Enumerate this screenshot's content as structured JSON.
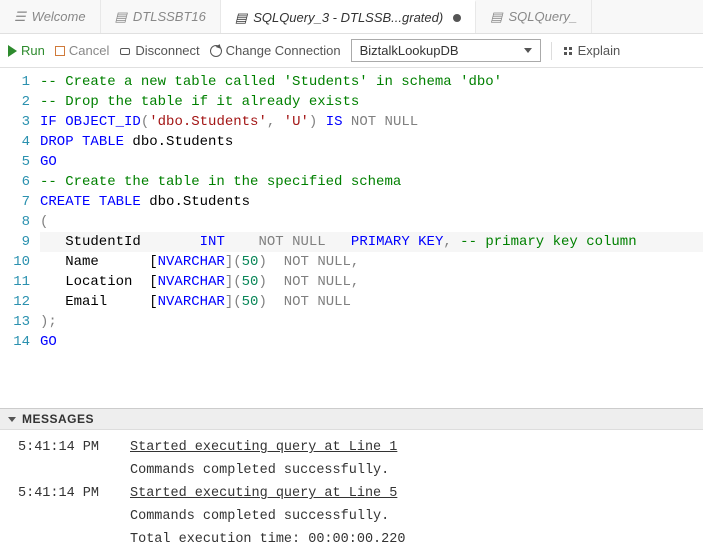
{
  "tabs": {
    "welcome": "Welcome",
    "t1": "DTLSSBT16",
    "active": "SQLQuery_3 - DTLSSB...grated)",
    "t3": "SQLQuery_"
  },
  "toolbar": {
    "run": "Run",
    "cancel": "Cancel",
    "disconnect": "Disconnect",
    "change_conn": "Change Connection",
    "db_selected": "BiztalkLookupDB",
    "explain": "Explain"
  },
  "editor": {
    "lines": {
      "l1": "-- Create a new table called 'Students' in schema 'dbo'",
      "l2": "-- Drop the table if it already exists",
      "l3_if": "IF",
      "l3_fn": " OBJECT_ID",
      "l3_p": "(",
      "l3_s1": "'dbo.Students'",
      "l3_c": ", ",
      "l3_s2": "'U'",
      "l3_p2": ") ",
      "l3_is": "IS",
      "l3_sp": " ",
      "l3_not": "NOT",
      "l3_sp2": " ",
      "l3_null": "NULL",
      "l4_drop": "DROP",
      "l4_sp": " ",
      "l4_table": "TABLE",
      "l4_rest": " dbo.Students",
      "l5": "GO",
      "l6": "-- Create the table in the specified schema",
      "l7_create": "CREATE",
      "l7_sp": " ",
      "l7_table": "TABLE",
      "l7_rest": " dbo.Students",
      "l8": "(",
      "l9_name": "   StudentId       ",
      "l9_type": "INT",
      "l9_sp": "    ",
      "l9_not": "NOT",
      "l9_sp2": " ",
      "l9_null": "NULL",
      "l9_sp3": "   ",
      "l9_pk": "PRIMARY",
      "l9_sp4": " ",
      "l9_key": "KEY",
      "l9_comma": ", ",
      "l9_cmt": "-- primary key column",
      "l10_name": "   Name      [",
      "l10_type": "NVARCHAR",
      "l10_b": "](",
      "l10_num": "50",
      "l10_p": ")  ",
      "l10_not": "NOT",
      "l10_sp": " ",
      "l10_null": "NULL",
      "l10_comma": ",",
      "l11_name": "   Location  [",
      "l11_type": "NVARCHAR",
      "l11_b": "](",
      "l11_num": "50",
      "l11_p": ")  ",
      "l11_not": "NOT",
      "l11_sp": " ",
      "l11_null": "NULL",
      "l11_comma": ",",
      "l12_name": "   Email     [",
      "l12_type": "NVARCHAR",
      "l12_b": "](",
      "l12_num": "50",
      "l12_p": ")  ",
      "l12_not": "NOT",
      "l12_sp": " ",
      "l12_null": "NULL",
      "l13": ");",
      "l14": "GO"
    },
    "line_numbers": [
      "1",
      "2",
      "3",
      "4",
      "5",
      "6",
      "7",
      "8",
      "9",
      "10",
      "11",
      "12",
      "13",
      "14"
    ]
  },
  "messages": {
    "header": "MESSAGES",
    "rows": [
      {
        "time": "5:41:14 PM",
        "text": "Started executing query at Line 1",
        "link": true
      },
      {
        "time": "",
        "text": "Commands completed successfully.",
        "link": false
      },
      {
        "time": "5:41:14 PM",
        "text": "Started executing query at Line 5",
        "link": true
      },
      {
        "time": "",
        "text": "Commands completed successfully.",
        "link": false
      },
      {
        "time": "",
        "text": "Total execution time: 00:00:00.220",
        "link": false
      }
    ]
  }
}
